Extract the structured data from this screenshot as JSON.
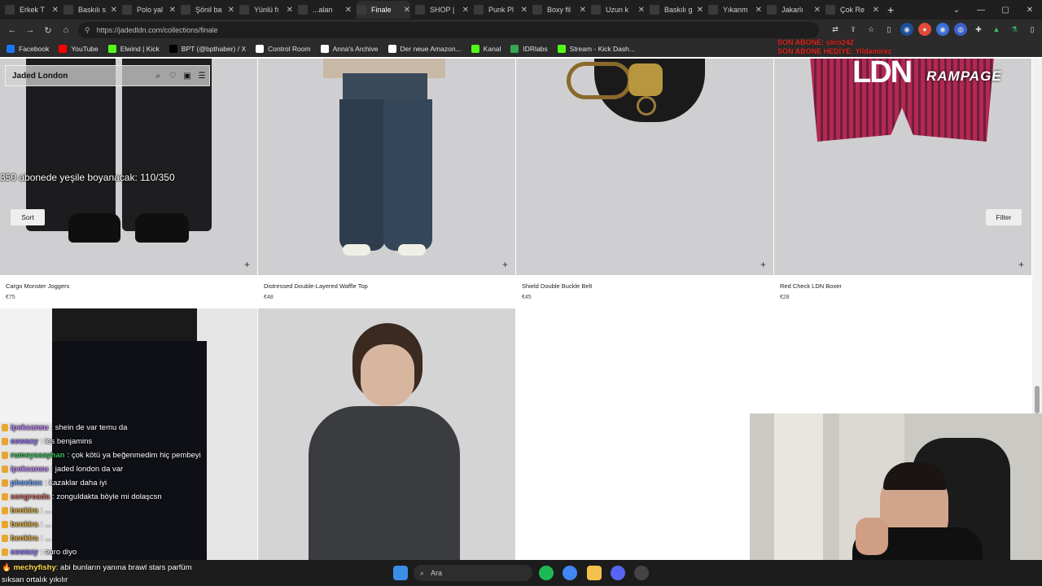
{
  "browser": {
    "tabs": [
      {
        "title": "Erkek T"
      },
      {
        "title": "Baskılı s"
      },
      {
        "title": "Polo yal"
      },
      {
        "title": "Şönil ba"
      },
      {
        "title": "Yünlü fı"
      },
      {
        "title": "...alan"
      },
      {
        "title": "Finale"
      },
      {
        "title": "SHOP |"
      },
      {
        "title": "Punk Pl"
      },
      {
        "title": "Boxy fil"
      },
      {
        "title": "Uzun k"
      },
      {
        "title": "Baskılı g"
      },
      {
        "title": "Yıkanm"
      },
      {
        "title": "Jakarlı"
      },
      {
        "title": "Çok Re"
      }
    ],
    "url": "https://jadedldn.com/collections/finale",
    "bookmarks": [
      {
        "label": "Facebook",
        "color": "#1877f2"
      },
      {
        "label": "YouTube",
        "color": "#ff0000"
      },
      {
        "label": "Elwind | Kick",
        "color": "#53fc18"
      },
      {
        "label": "BPT (@bpthaber) / X",
        "color": "#000000"
      },
      {
        "label": "Control Room",
        "color": "#ffffff"
      },
      {
        "label": "Anna's Archive",
        "color": "#ffffff"
      },
      {
        "label": "Der neue Amazon...",
        "color": "#ffffff"
      },
      {
        "label": "Kanal",
        "color": "#53fc18"
      },
      {
        "label": "IDRlabs",
        "color": "#34a853"
      },
      {
        "label": "Stream - Kick Dash...",
        "color": "#53fc18"
      }
    ]
  },
  "site": {
    "logo": "Jaded London",
    "sort_label": "Sort",
    "filter_label": "Filter",
    "products": [
      {
        "name": "Cargo Monster Joggers",
        "price": "€75"
      },
      {
        "name": "Distressed Double-Layered Waffle Top",
        "price": "€48"
      },
      {
        "name": "Shield Double Buckle Belt",
        "price": "€45"
      },
      {
        "name": "Red Check LDN Boxer",
        "price": "€28"
      }
    ],
    "plus": "+"
  },
  "overlay": {
    "sub_goal": "350 abonede yeşile boyanacak: 110/350",
    "son_abone": "SON ABONE: sliro242",
    "son_abone_hediye": "SON ABONE HEDİYE: Yildamirez",
    "rampage": "RAMPAGE"
  },
  "chat": [
    {
      "user": "ipekcansu",
      "msg": ": shein de var temu da",
      "color": "#c28bff"
    },
    {
      "user": "cewsxy",
      "msg": ": les benjamins",
      "color": "#9b7bff"
    },
    {
      "user": "rumeysaayhan",
      "msg": ": çok kötü ya beğenmedim hiç pembeyi",
      "color": "#3dbd5a"
    },
    {
      "user": "ipekcansu",
      "msg": ": jaded london da var",
      "color": "#c28bff"
    },
    {
      "user": "phoebex",
      "msg": ": kazaklar daha iyi",
      "color": "#6fa8ff"
    },
    {
      "user": "sengroada",
      "msg": ": zonguldakta böyle mi dolaşcsn",
      "color": "#d06a6a"
    },
    {
      "user": "benkira",
      "msg": ": ...",
      "color": "#e0b040"
    },
    {
      "user": "benkira",
      "msg": ": ...",
      "color": "#e0b040"
    },
    {
      "user": "benkira",
      "msg": ": ...",
      "color": "#e0b040"
    },
    {
      "user": "cewsxy",
      "msg": ": euro diyo",
      "color": "#9b7bff"
    }
  ],
  "bottom_chat": {
    "user": "mechyfishy",
    "msg": ": abi bunların yanına brawl stars parfüm",
    "msg2": "sıksan ortalık yıkılır"
  },
  "taskbar": {
    "search_placeholder": "Ara"
  }
}
